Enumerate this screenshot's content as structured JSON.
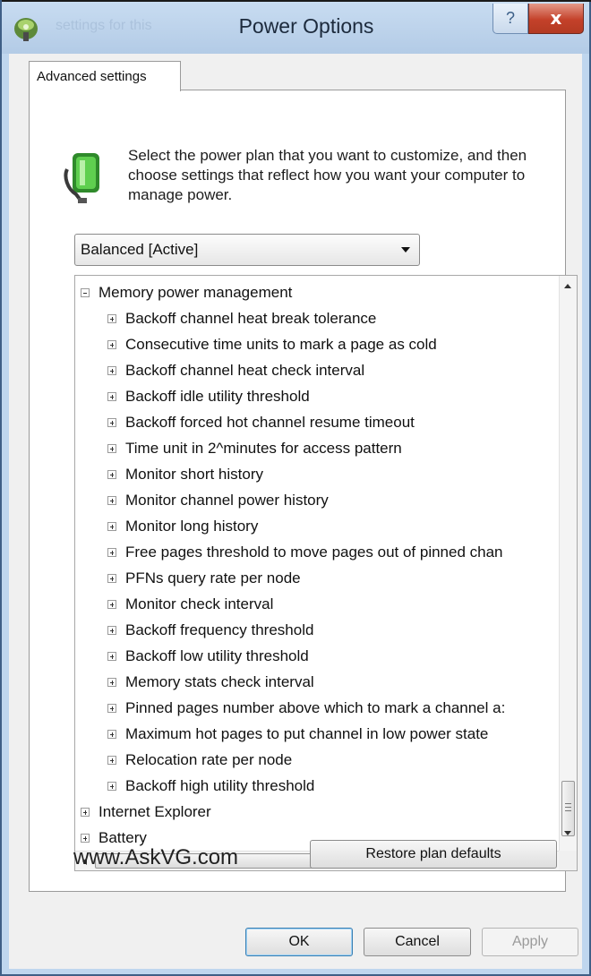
{
  "window": {
    "title": "Power Options",
    "ghost_title": "settings for this",
    "help_label": "?",
    "close_label": "x"
  },
  "tabs": [
    {
      "label": "Advanced settings",
      "selected": true
    }
  ],
  "intro": {
    "text": "Select the power plan that you want to customize, and then choose settings that reflect how you want your computer to manage power."
  },
  "plan_select": {
    "value": "Balanced [Active]"
  },
  "tree": {
    "items": [
      {
        "label": "Memory power management",
        "level": 0,
        "expanded": true
      },
      {
        "label": "Backoff channel heat break tolerance",
        "level": 1,
        "expanded": false
      },
      {
        "label": "Consecutive time units to mark a page as cold",
        "level": 1,
        "expanded": false
      },
      {
        "label": "Backoff channel heat check interval",
        "level": 1,
        "expanded": false
      },
      {
        "label": "Backoff idle utility threshold",
        "level": 1,
        "expanded": false
      },
      {
        "label": "Backoff forced hot channel resume timeout",
        "level": 1,
        "expanded": false
      },
      {
        "label": "Time unit in 2^minutes for access pattern",
        "level": 1,
        "expanded": false
      },
      {
        "label": "Monitor short history",
        "level": 1,
        "expanded": false
      },
      {
        "label": "Monitor channel power history",
        "level": 1,
        "expanded": false
      },
      {
        "label": "Monitor long history",
        "level": 1,
        "expanded": false
      },
      {
        "label": "Free pages threshold to move pages out of pinned chan",
        "level": 1,
        "expanded": false
      },
      {
        "label": "PFNs query rate per node",
        "level": 1,
        "expanded": false
      },
      {
        "label": "Monitor check interval",
        "level": 1,
        "expanded": false
      },
      {
        "label": "Backoff frequency threshold",
        "level": 1,
        "expanded": false
      },
      {
        "label": "Backoff low utility threshold",
        "level": 1,
        "expanded": false
      },
      {
        "label": "Memory stats check interval",
        "level": 1,
        "expanded": false
      },
      {
        "label": "Pinned pages number above which to mark a channel a:",
        "level": 1,
        "expanded": false
      },
      {
        "label": "Maximum hot pages to put channel in low power state",
        "level": 1,
        "expanded": false
      },
      {
        "label": "Relocation rate per node",
        "level": 1,
        "expanded": false
      },
      {
        "label": "Backoff high utility threshold",
        "level": 1,
        "expanded": false
      },
      {
        "label": "Internet Explorer",
        "level": 0,
        "expanded": false
      },
      {
        "label": "Battery",
        "level": 0,
        "expanded": false
      }
    ],
    "hscroll_grip": "III"
  },
  "footer": {
    "watermark": "www.AskVG.com",
    "restore_label": "Restore plan defaults"
  },
  "buttons": {
    "ok": "OK",
    "cancel": "Cancel",
    "apply": "Apply"
  },
  "colors": {
    "frame": "#bfd6ee",
    "close_red": "#c4412a",
    "ok_border": "#3c7fb1"
  }
}
